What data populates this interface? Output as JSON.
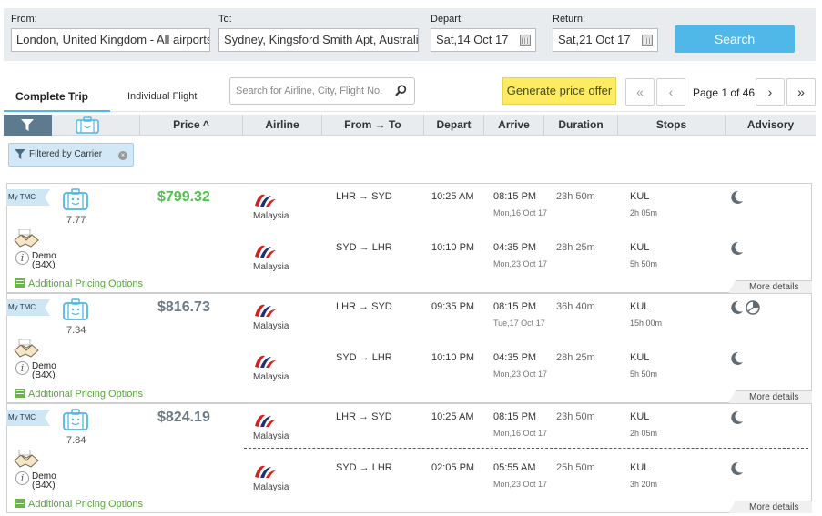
{
  "search": {
    "from_label": "From:",
    "from_value": "London, United Kingdom - All airports",
    "to_label": "To:",
    "to_value": "Sydney, Kingsford Smith Apt, Australia",
    "depart_label": "Depart:",
    "depart_value": "Sat,14 Oct 17",
    "return_label": "Return:",
    "return_value": "Sat,21 Oct 17",
    "search_button": "Search"
  },
  "tabs": {
    "complete": "Complete Trip",
    "individual": "Individual Flight"
  },
  "filter_search": {
    "placeholder": "Search for Airline, City, Flight No."
  },
  "generate_button": "Generate price offer",
  "pager": {
    "first": "«",
    "prev": "‹",
    "info": "Page 1 of 46",
    "next": "›",
    "last": "»"
  },
  "columns": {
    "price": "Price ^",
    "airline": "Airline",
    "from_to": "From → To",
    "depart": "Depart",
    "arrive": "Arrive",
    "duration": "Duration",
    "stops": "Stops",
    "advisory": "Advisory"
  },
  "filter_chip": "Filtered by Carrier",
  "results": [
    {
      "tmc": "My TMC",
      "score": "7.77",
      "price": "$799.32",
      "best": true,
      "demo": "Demo",
      "demo_code": "(B4X)",
      "pricing": "Additional Pricing Options",
      "more": "More details",
      "legs": [
        {
          "airline": "Malaysia",
          "route": "LHR → SYD",
          "depart": "10:25 AM",
          "arrive": "08:15 PM",
          "arrive_date": "Mon,16 Oct 17",
          "duration": "23h 50m",
          "stop": "KUL",
          "stop_dur": "2h 05m",
          "advisory": [
            "night-icon"
          ]
        },
        {
          "airline": "Malaysia",
          "route": "SYD → LHR",
          "depart": "10:10 PM",
          "arrive": "04:35 PM",
          "arrive_date": "Mon,23 Oct 17",
          "duration": "28h 25m",
          "stop": "KUL",
          "stop_dur": "5h 50m",
          "advisory": [
            "night-icon"
          ]
        }
      ]
    },
    {
      "tmc": "My TMC",
      "score": "7.34",
      "price": "$816.73",
      "best": false,
      "demo": "Demo",
      "demo_code": "(B4X)",
      "pricing": "Additional Pricing Options",
      "more": "More details",
      "legs": [
        {
          "airline": "Malaysia",
          "route": "LHR → SYD",
          "depart": "09:35 PM",
          "arrive": "08:15 PM",
          "arrive_date": "Tue,17 Oct 17",
          "duration": "36h 40m",
          "stop": "KUL",
          "stop_dur": "15h 00m",
          "advisory": [
            "night-icon",
            "long-layover-icon"
          ]
        },
        {
          "airline": "Malaysia",
          "route": "SYD → LHR",
          "depart": "10:10 PM",
          "arrive": "04:35 PM",
          "arrive_date": "Mon,23 Oct 17",
          "duration": "28h 25m",
          "stop": "KUL",
          "stop_dur": "5h 50m",
          "advisory": [
            "night-icon"
          ]
        }
      ]
    },
    {
      "tmc": "My TMC",
      "score": "7.84",
      "price": "$824.19",
      "best": false,
      "demo": "Demo",
      "demo_code": "(B4X)",
      "pricing": "Additional Pricing Options",
      "more": "More details",
      "legs": [
        {
          "airline": "Malaysia",
          "route": "LHR → SYD",
          "depart": "10:25 AM",
          "arrive": "08:15 PM",
          "arrive_date": "Mon,16 Oct 17",
          "duration": "23h 50m",
          "stop": "KUL",
          "stop_dur": "2h 05m",
          "advisory": [
            "night-icon"
          ]
        },
        {
          "airline": "Malaysia",
          "route": "SYD → LHR",
          "depart": "02:05 PM",
          "arrive": "05:55 AM",
          "arrive_date": "Mon,23 Oct 17",
          "duration": "25h 50m",
          "stop": "KUL",
          "stop_dur": "3h 20m",
          "advisory": [
            "night-icon"
          ]
        }
      ]
    }
  ],
  "colors": {
    "accent": "#4fb8e8",
    "best_price": "#4ec24a",
    "price": "#6c7a86",
    "pricing_link": "#5ba33e",
    "generate": "#fdeb63"
  }
}
